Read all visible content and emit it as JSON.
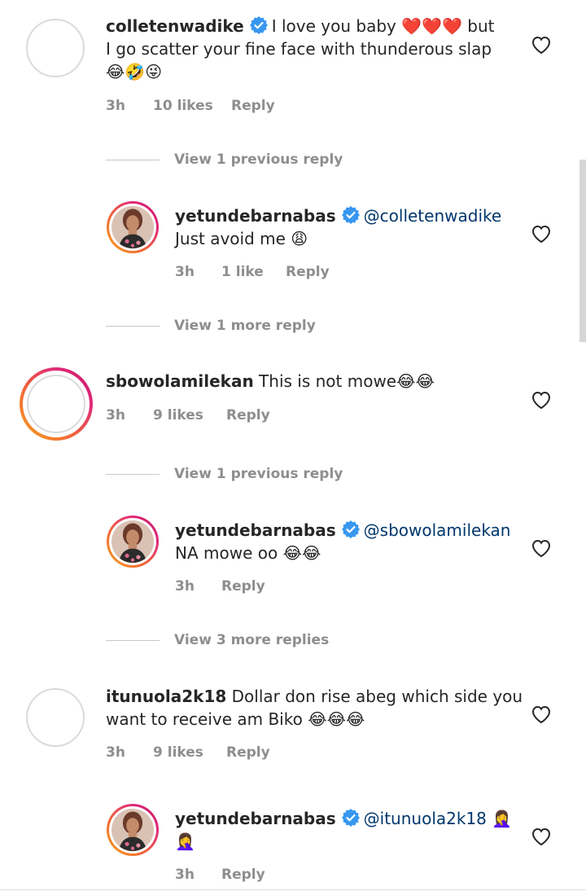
{
  "comments": [
    {
      "username": "colletenwadike",
      "text_line1": "I love you baby ❤️❤️❤️ but",
      "text_line2": "I go scatter your fine face with thunderous slap",
      "text_line3": "😂🤣😜",
      "time": "3h",
      "likes": "10 likes",
      "reply": "Reply"
    },
    {
      "view_more": "View 1 previous reply"
    },
    {
      "username": "yetundebarnabas",
      "mention": "@colletenwadike",
      "text": "Just avoid me 😩",
      "time": "3h",
      "likes": "1 like",
      "reply": "Reply"
    },
    {
      "view_more": "View 1 more reply"
    },
    {
      "username": "sbowolamilekan",
      "text": "This is not mowe😂😂",
      "time": "3h",
      "likes": "9 likes",
      "reply": "Reply"
    },
    {
      "view_more": "View 1 previous reply"
    },
    {
      "username": "yetundebarnabas",
      "mention": "@sbowolamilekan",
      "text": "NA mowe oo 😂😂",
      "time": "3h",
      "reply": "Reply"
    },
    {
      "view_more": "View 3 more replies"
    },
    {
      "username": "itunuola2k18",
      "text_line1": "Dollar don rise abeg which side you",
      "text_line2": "want to receive am Biko 😂😂😂",
      "time": "3h",
      "likes": "9 likes",
      "reply": "Reply"
    },
    {
      "username": "yetundebarnabas",
      "mention": "@itunuola2k18",
      "text_line1": "🤦‍♀️",
      "text_line2": "🤦‍♀️",
      "time": "3h",
      "reply": "Reply"
    }
  ],
  "icons": {
    "like": "heart-outline-icon",
    "verified": "verified-badge-icon"
  },
  "colors": {
    "mention": "#00376b",
    "meta": "#8e8e8e",
    "verified": "#3897f0"
  }
}
